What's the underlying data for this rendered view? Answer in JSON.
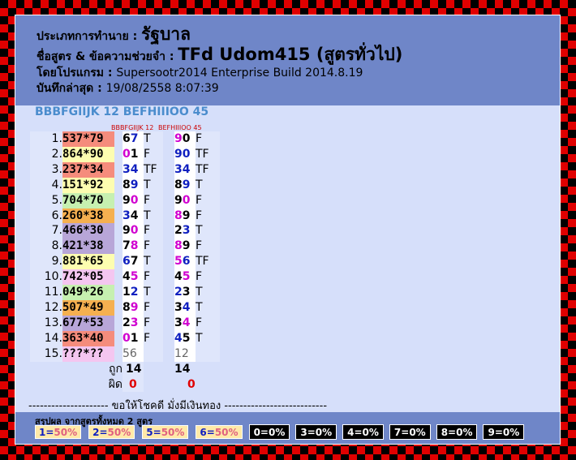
{
  "header": {
    "type_label": "ประเภทการทำนาย :",
    "type_value": "รัฐบาล",
    "formula_label": "ชื่อสูตร & ข้อความช่วยจำ :",
    "formula_value": "TFd Udom415 (สูตรทั่วไป)",
    "program_label": "โดยโปรแกรม :",
    "program_value": "Supersootr2014 Enterprise Build 2014.8.19",
    "saved_label": "บันทึกล่าสุด :",
    "saved_value": "19/08/2558 8:07:39"
  },
  "sub_title": "BBBFGIIJK 12 BEFHIIIOO 45",
  "col1_small": "BBBFGIIJK 12",
  "col2_small": "BEFHIIIOO 45",
  "rows": [
    {
      "no": "1.",
      "bet": "537*79",
      "bg": "#f58c7c",
      "a1": "6",
      "a2": "7",
      "c1": "k",
      "c2": "b",
      "r1": "T",
      "b1": "9",
      "b2": "0",
      "d1": "m",
      "d2": "k",
      "r2": "F"
    },
    {
      "no": "2.",
      "bet": "864*90",
      "bg": "#fdfdb0",
      "a1": "0",
      "a2": "1",
      "c1": "m",
      "c2": "k",
      "r1": "F",
      "b1": "9",
      "b2": "0",
      "d1": "b",
      "d2": "b",
      "r2": "TF"
    },
    {
      "no": "3.",
      "bet": "237*34",
      "bg": "#f58c7c",
      "a1": "3",
      "a2": "4",
      "c1": "b",
      "c2": "b",
      "r1": "TF",
      "b1": "3",
      "b2": "4",
      "d1": "b",
      "d2": "b",
      "r2": "TF"
    },
    {
      "no": "4.",
      "bet": "151*92",
      "bg": "#fdfdb0",
      "a1": "8",
      "a2": "9",
      "c1": "k",
      "c2": "b",
      "r1": "T",
      "b1": "8",
      "b2": "9",
      "d1": "k",
      "d2": "b",
      "r2": "T"
    },
    {
      "no": "5.",
      "bet": "704*70",
      "bg": "#c6f0b0",
      "a1": "9",
      "a2": "0",
      "c1": "k",
      "c2": "m",
      "r1": "F",
      "b1": "9",
      "b2": "0",
      "d1": "k",
      "d2": "m",
      "r2": "F"
    },
    {
      "no": "6.",
      "bet": "260*38",
      "bg": "#f5b050",
      "a1": "3",
      "a2": "4",
      "c1": "b",
      "c2": "k",
      "r1": "T",
      "b1": "8",
      "b2": "9",
      "d1": "m",
      "d2": "k",
      "r2": "F"
    },
    {
      "no": "7.",
      "bet": "466*30",
      "bg": "#b8a6d8",
      "a1": "9",
      "a2": "0",
      "c1": "k",
      "c2": "m",
      "r1": "F",
      "b1": "2",
      "b2": "3",
      "d1": "k",
      "d2": "b",
      "r2": "T"
    },
    {
      "no": "8.",
      "bet": "421*38",
      "bg": "#b8a6d8",
      "a1": "7",
      "a2": "8",
      "c1": "k",
      "c2": "m",
      "r1": "F",
      "b1": "8",
      "b2": "9",
      "d1": "m",
      "d2": "k",
      "r2": "F"
    },
    {
      "no": "9.",
      "bet": "881*65",
      "bg": "#fdfdb0",
      "a1": "6",
      "a2": "7",
      "c1": "b",
      "c2": "k",
      "r1": "T",
      "b1": "5",
      "b2": "6",
      "d1": "m",
      "d2": "b",
      "r2": "TF"
    },
    {
      "no": "10.",
      "bet": "742*05",
      "bg": "#f4c6f0",
      "a1": "4",
      "a2": "5",
      "c1": "k",
      "c2": "m",
      "r1": "F",
      "b1": "4",
      "b2": "5",
      "d1": "k",
      "d2": "m",
      "r2": "F"
    },
    {
      "no": "11.",
      "bet": "049*26",
      "bg": "#c6f0b0",
      "a1": "1",
      "a2": "2",
      "c1": "k",
      "c2": "b",
      "r1": "T",
      "b1": "2",
      "b2": "3",
      "d1": "b",
      "d2": "k",
      "r2": "T"
    },
    {
      "no": "12.",
      "bet": "507*49",
      "bg": "#f5b050",
      "a1": "8",
      "a2": "9",
      "c1": "k",
      "c2": "m",
      "r1": "F",
      "b1": "3",
      "b2": "4",
      "d1": "k",
      "d2": "b",
      "r2": "T"
    },
    {
      "no": "13.",
      "bet": "677*53",
      "bg": "#b8a6d8",
      "a1": "2",
      "a2": "3",
      "c1": "k",
      "c2": "m",
      "r1": "F",
      "b1": "3",
      "b2": "4",
      "d1": "k",
      "d2": "m",
      "r2": "F"
    },
    {
      "no": "14.",
      "bet": "363*40",
      "bg": "#f58c7c",
      "a1": "0",
      "a2": "1",
      "c1": "m",
      "c2": "k",
      "r1": "F",
      "b1": "4",
      "b2": "5",
      "d1": "b",
      "d2": "k",
      "r2": "T"
    },
    {
      "no": "15.",
      "bet": "???*??",
      "bg": "#f4c6f0",
      "a1": "5",
      "a2": "6",
      "c1": "g",
      "c2": "g",
      "r1": "",
      "b1": "1",
      "b2": "2",
      "d1": "g",
      "d2": "g",
      "r2": ""
    }
  ],
  "totals": {
    "right_label": "ถูก",
    "wrong_label": "ผิด",
    "right1": "14",
    "wrong1": "0",
    "right2": "14",
    "wrong2": "0",
    "wrong_color": "#e00000"
  },
  "luck_line": "--------------------- ขอให้โชคดี มั่งมีเงินทอง ---------------------------",
  "summary": {
    "title": "สรุปผล จากสูตรทั้งหมด 2 สูตร",
    "chips": [
      {
        "k": "1=",
        "v": "50%",
        "style": "y"
      },
      {
        "k": "2=",
        "v": "50%",
        "style": "y"
      },
      {
        "k": "5=",
        "v": "50%",
        "style": "y"
      },
      {
        "k": "6=",
        "v": "50%",
        "style": "y"
      },
      {
        "k": "0=",
        "v": "0%",
        "style": "bk"
      },
      {
        "k": "3=",
        "v": "0%",
        "style": "bk"
      },
      {
        "k": "4=",
        "v": "0%",
        "style": "bk"
      },
      {
        "k": "7=",
        "v": "0%",
        "style": "bk"
      },
      {
        "k": "8=",
        "v": "0%",
        "style": "bk"
      },
      {
        "k": "9=",
        "v": "0%",
        "style": "bk"
      }
    ]
  },
  "colors": {
    "header_bg": "#6f86c8",
    "panel_bg": "#d6dffa",
    "frame_red": "#e00000",
    "frame_black": "#000000"
  }
}
